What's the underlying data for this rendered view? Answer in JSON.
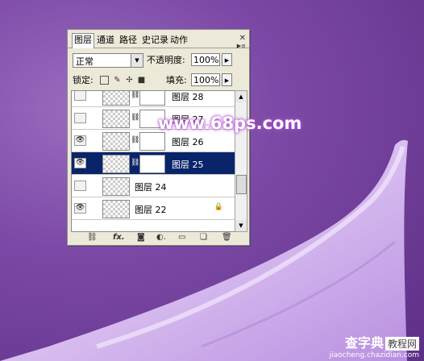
{
  "tabs": [
    "图层",
    "通道",
    "路径",
    "史记录",
    "动作"
  ],
  "blend_mode": "正常",
  "opacity_label": "不透明度:",
  "opacity_value": "100%",
  "lock_label": "锁定:",
  "fill_label": "填充:",
  "fill_value": "100%",
  "layers": [
    {
      "name": "图层 28",
      "visible": false,
      "selected": false,
      "has_mask": true,
      "locked": false
    },
    {
      "name": "图层 27",
      "visible": false,
      "selected": false,
      "has_mask": true,
      "locked": false
    },
    {
      "name": "图层 26",
      "visible": true,
      "selected": false,
      "has_mask": true,
      "locked": false
    },
    {
      "name": "图层 25",
      "visible": true,
      "selected": true,
      "has_mask": true,
      "locked": false
    },
    {
      "name": "图层 24",
      "visible": false,
      "selected": false,
      "has_mask": false,
      "locked": false
    },
    {
      "name": "图层 22",
      "visible": true,
      "selected": false,
      "has_mask": false,
      "locked": true
    }
  ],
  "watermark": "www.68ps.com",
  "brand_top": "查字典",
  "brand_tag": "教程网",
  "brand_url": "jiaocheng.chazidian.com",
  "icons": [
    "eye-icon",
    "chain-icon",
    "lock-icon",
    "fx-icon",
    "mask-icon",
    "adjustment-icon",
    "folder-icon",
    "new-layer-icon",
    "trash-icon"
  ],
  "colors": {
    "background": "#7c4aa6",
    "selected_row": "#0a246a",
    "silk": "#e3cef5"
  }
}
